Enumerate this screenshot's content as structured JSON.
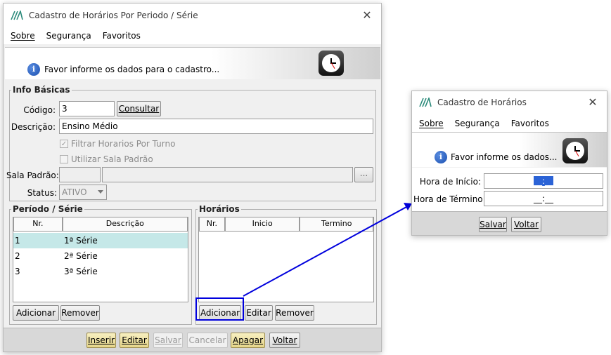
{
  "main_window": {
    "title": "Cadastro de Horários Por Periodo / Série",
    "menu": [
      "Sobre",
      "Segurança",
      "Favoritos"
    ],
    "banner_text": "Favor informe os dados para o cadastro...",
    "info_basicas": {
      "legend": "Info Básicas",
      "codigo_label": "Código:",
      "codigo_value": "3",
      "consultar_label": "Consultar",
      "descricao_label": "Descrição:",
      "descricao_value": "Ensino Médio",
      "filtrar_label": "Filtrar Horarios Por Turno",
      "filtrar_checked": true,
      "sala_padrao_check_label": "Utilizar Sala Padrão",
      "sala_padrao_checked": false,
      "sala_label": "Sala Padrão:",
      "sala_button": "...",
      "status_label": "Status:",
      "status_value": "ATIVO"
    },
    "periodo": {
      "legend": "Período / Série",
      "columns": [
        "Nr.",
        "Descrição"
      ],
      "rows": [
        {
          "nr": "1",
          "desc": "1ª Série"
        },
        {
          "nr": "2",
          "desc": "2ª Série"
        },
        {
          "nr": "3",
          "desc": "3ª Série"
        }
      ],
      "add_label": "Adicionar",
      "remove_label": "Remover"
    },
    "horarios": {
      "legend": "Horários",
      "columns": [
        "Nr.",
        "Inicio",
        "Termino"
      ],
      "add_label": "Adicionar",
      "edit_label": "Editar",
      "remove_label": "Remover"
    },
    "footer": {
      "inserir": "Inserir",
      "editar": "Editar",
      "salvar": "Salvar",
      "cancelar": "Cancelar",
      "apagar": "Apagar",
      "voltar": "Voltar"
    }
  },
  "dialog": {
    "title": "Cadastro de Horários",
    "menu": [
      "Sobre",
      "Segurança",
      "Favoritos"
    ],
    "banner_text": "Favor informe os dados...",
    "inicio_label": "Hora de Início:",
    "inicio_value": "__:__",
    "termino_label": "Hora de Término:",
    "termino_value": "__:__",
    "salvar": "Salvar",
    "voltar": "Voltar"
  },
  "annotation_color": "#0000dd"
}
